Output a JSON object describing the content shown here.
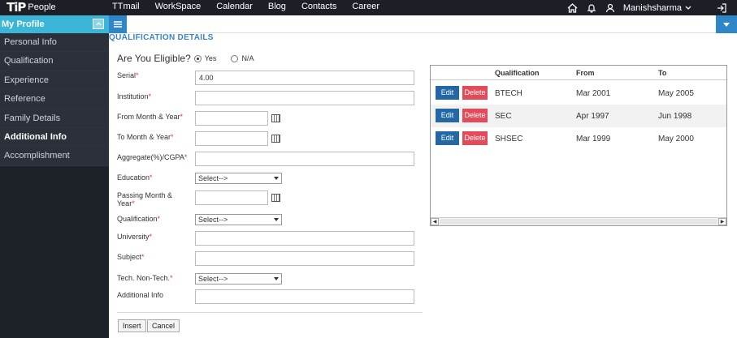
{
  "brand": {
    "logo": "TiP",
    "name": "People"
  },
  "topnav": [
    "TTmail",
    "WorkSpace",
    "Calendar",
    "Blog",
    "Contacts",
    "Career"
  ],
  "user": {
    "name": "Manishsharma"
  },
  "icons": {
    "home": "home-icon",
    "bell": "bell-icon",
    "profile": "user-icon",
    "logout": "logout-icon"
  },
  "colors": {
    "topbar": "#1c1f26",
    "sidebar_header": "#3bb5d8",
    "accent": "#2e86c9",
    "edit": "#2367a5",
    "delete": "#e34a5a",
    "required": "#e53935"
  },
  "sidebar": {
    "title": "My Profile",
    "items": [
      "Personal Info",
      "Qualification",
      "Experience",
      "Reference",
      "Family Details",
      "Additional Info",
      "Accomplishment"
    ],
    "active": "Additional Info"
  },
  "section_title": "QUALIFICATION DETAILS",
  "eligibility": {
    "question": "Are You Eligible?",
    "options": [
      "Yes",
      "N/A"
    ],
    "selected": "Yes"
  },
  "form": {
    "serial": {
      "label": "Serial",
      "required": "*",
      "value": "4.00"
    },
    "institution": {
      "label": "Institution",
      "required": "*",
      "value": ""
    },
    "from": {
      "label": "From Month & Year",
      "required": "*",
      "value": ""
    },
    "to": {
      "label": "To Month & Year",
      "required": "*",
      "value": ""
    },
    "aggregate": {
      "label": "Aggregate(%)/CGPA",
      "required": "*",
      "value": ""
    },
    "education": {
      "label": "Education",
      "required": "*",
      "selected": "Select-->"
    },
    "passing_l1": "Passing Month &",
    "passing_l2": "Year",
    "passing_req": "*",
    "qualification": {
      "label": "Qualification",
      "required": "*",
      "selected": "Select-->"
    },
    "university": {
      "label": "University",
      "required": "*",
      "value": ""
    },
    "subject": {
      "label": "Subject",
      "required": "*",
      "value": ""
    },
    "tech": {
      "label": "Tech. Non-Tech.",
      "required": "*",
      "selected": "Select-->"
    },
    "additional": {
      "label": "Additional Info",
      "value": ""
    }
  },
  "buttons": {
    "insert": "Insert",
    "cancel": "Cancel"
  },
  "grid": {
    "headers": [
      "Qualification",
      "From",
      "To"
    ],
    "edit_label": "Edit",
    "delete_label": "Delete",
    "rows": [
      {
        "qualification": "BTECH",
        "from": "Mar 2001",
        "to": "May 2005"
      },
      {
        "qualification": "SEC",
        "from": "Apr 1997",
        "to": "Jun 1998"
      },
      {
        "qualification": "SHSEC",
        "from": "Mar 1999",
        "to": "May 2000"
      }
    ]
  }
}
